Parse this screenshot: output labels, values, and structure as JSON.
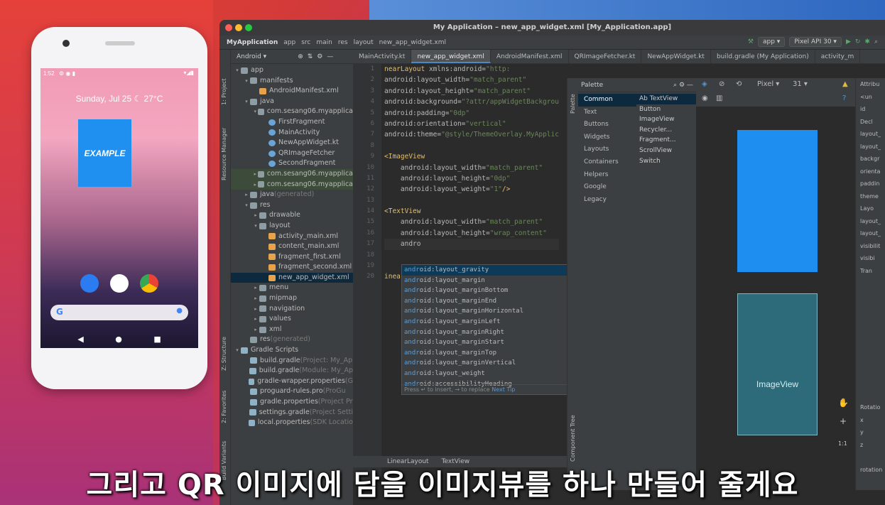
{
  "phone": {
    "status_time": "1:52",
    "status_icons": "⚙ ◉ ▮",
    "status_right": "▾◢▮",
    "date_weather": "Sunday, Jul 25 ☾ 27°C",
    "widget_label": "EXAMPLE",
    "search_logo": "G",
    "mic": "●",
    "nav_back": "◀",
    "nav_home": "●",
    "nav_recents": "■"
  },
  "ide": {
    "window_title": "My Application – new_app_widget.xml [My_Application.app]",
    "breadcrumbs": [
      "MyApplication",
      "app",
      "src",
      "main",
      "res",
      "layout",
      "new_app_widget.xml"
    ],
    "run_config": "app ▾",
    "device": "Pixel API 30 ▾",
    "tabs": [
      "MainActivity.kt",
      "new_app_widget.xml",
      "AndroidManifest.xml",
      "QRImageFetcher.kt",
      "NewAppWidget.kt",
      "build.gradle (My Application)",
      "activity_m"
    ],
    "project_view": "Android ▾",
    "left_strip": [
      "1: Project",
      "Resource Manager",
      "Z: Structure",
      "2: Favorites",
      "Build Variants"
    ],
    "tree": [
      {
        "label": "app",
        "indent": 0,
        "arrow": "▾",
        "icon": "fold"
      },
      {
        "label": "manifests",
        "indent": 1,
        "arrow": "▾",
        "icon": "fold"
      },
      {
        "label": "AndroidManifest.xml",
        "indent": 2,
        "arrow": "",
        "icon": "xml"
      },
      {
        "label": "java",
        "indent": 1,
        "arrow": "▾",
        "icon": "fold"
      },
      {
        "label": "com.sesang06.myapplica",
        "indent": 2,
        "arrow": "▾",
        "icon": "fold"
      },
      {
        "label": "FirstFragment",
        "indent": 3,
        "arrow": "",
        "icon": "kt"
      },
      {
        "label": "MainActivity",
        "indent": 3,
        "arrow": "",
        "icon": "kt"
      },
      {
        "label": "NewAppWidget.kt",
        "indent": 3,
        "arrow": "",
        "icon": "kt"
      },
      {
        "label": "QRImageFetcher",
        "indent": 3,
        "arrow": "",
        "icon": "kt"
      },
      {
        "label": "SecondFragment",
        "indent": 3,
        "arrow": "",
        "icon": "kt"
      },
      {
        "label": "com.sesang06.myapplica",
        "indent": 2,
        "arrow": "▸",
        "icon": "fold",
        "hl": true
      },
      {
        "label": "com.sesang06.myapplica",
        "indent": 2,
        "arrow": "▸",
        "icon": "fold",
        "hl": true
      },
      {
        "label": "java",
        "indent": 1,
        "arrow": "▸",
        "icon": "fold",
        "note": " (generated)"
      },
      {
        "label": "res",
        "indent": 1,
        "arrow": "▾",
        "icon": "fold"
      },
      {
        "label": "drawable",
        "indent": 2,
        "arrow": "▸",
        "icon": "fold"
      },
      {
        "label": "layout",
        "indent": 2,
        "arrow": "▾",
        "icon": "fold"
      },
      {
        "label": "activity_main.xml",
        "indent": 3,
        "arrow": "",
        "icon": "xml"
      },
      {
        "label": "content_main.xml",
        "indent": 3,
        "arrow": "",
        "icon": "xml"
      },
      {
        "label": "fragment_first.xml",
        "indent": 3,
        "arrow": "",
        "icon": "xml"
      },
      {
        "label": "fragment_second.xml",
        "indent": 3,
        "arrow": "",
        "icon": "xml"
      },
      {
        "label": "new_app_widget.xml",
        "indent": 3,
        "arrow": "",
        "icon": "xml",
        "sel": true
      },
      {
        "label": "menu",
        "indent": 2,
        "arrow": "▸",
        "icon": "fold"
      },
      {
        "label": "mipmap",
        "indent": 2,
        "arrow": "▸",
        "icon": "fold"
      },
      {
        "label": "navigation",
        "indent": 2,
        "arrow": "▸",
        "icon": "fold"
      },
      {
        "label": "values",
        "indent": 2,
        "arrow": "▸",
        "icon": "fold"
      },
      {
        "label": "xml",
        "indent": 2,
        "arrow": "▸",
        "icon": "fold"
      },
      {
        "label": "res",
        "indent": 1,
        "arrow": "",
        "icon": "fold",
        "note": " (generated)"
      },
      {
        "label": "Gradle Scripts",
        "indent": 0,
        "arrow": "▾",
        "icon": "grd"
      },
      {
        "label": "build.gradle",
        "indent": 1,
        "arrow": "",
        "icon": "grd",
        "note": " (Project: My_Ap"
      },
      {
        "label": "build.gradle",
        "indent": 1,
        "arrow": "",
        "icon": "grd",
        "note": " (Module: My_Ap"
      },
      {
        "label": "gradle-wrapper.properties",
        "indent": 1,
        "arrow": "",
        "icon": "grd",
        "note": " (G"
      },
      {
        "label": "proguard-rules.pro",
        "indent": 1,
        "arrow": "",
        "icon": "grd",
        "note": " (ProGu"
      },
      {
        "label": "gradle.properties",
        "indent": 1,
        "arrow": "",
        "icon": "grd",
        "note": " (Project Pr"
      },
      {
        "label": "settings.gradle",
        "indent": 1,
        "arrow": "",
        "icon": "grd",
        "note": " (Project Setti"
      },
      {
        "label": "local.properties",
        "indent": 1,
        "arrow": "",
        "icon": "grd",
        "note": " (SDK Locatio"
      }
    ],
    "code_lines": [
      {
        "n": "1",
        "html": "<span class='t'>nearLayout</span> <span class='a'>xmlns:android=</span><span class='v'>\"http:</span>"
      },
      {
        "n": "2",
        "html": "<span class='a'>android:layout_width=</span><span class='v'>\"match_parent\"</span>"
      },
      {
        "n": "3",
        "html": "<span class='a'>android:layout_height=</span><span class='v'>\"match_parent\"</span>"
      },
      {
        "n": "4",
        "html": "<span class='a'>android:background=</span><span class='v'>\"?attr/appWidgetBackgrou</span>"
      },
      {
        "n": "5",
        "html": "<span class='a'>android:padding=</span><span class='v'>\"0dp\"</span>"
      },
      {
        "n": "6",
        "html": "<span class='a'>android:orientation=</span><span class='v'>\"vertical\"</span>"
      },
      {
        "n": "7",
        "html": "<span class='a'>android:theme=</span><span class='v'>\"@style/ThemeOverlay.MyApplic</span>"
      },
      {
        "n": "8",
        "html": ""
      },
      {
        "n": "9",
        "html": "<span class='t'>&lt;ImageView</span>"
      },
      {
        "n": "10",
        "html": "    <span class='a'>android:layout_width=</span><span class='v'>\"match_parent\"</span>"
      },
      {
        "n": "11",
        "html": "    <span class='a'>android:layout_height=</span><span class='v'>\"0dp\"</span>"
      },
      {
        "n": "12",
        "html": "    <span class='a'>android:layout_weight=</span><span class='v'>\"1\"</span><span class='t'>/&gt;</span>"
      },
      {
        "n": "13",
        "html": ""
      },
      {
        "n": "14",
        "html": "<span class='t'>&lt;TextView</span>"
      },
      {
        "n": "15",
        "html": "    <span class='a'>android:layout_width=</span><span class='v'>\"match_parent\"</span>"
      },
      {
        "n": "16",
        "html": "    <span class='a'>android:layout_height=</span><span class='v'>\"wrap_content\"</span>"
      },
      {
        "n": "17",
        "html": "    <span class='a'>andro</span>",
        "cur": true
      },
      {
        "n": "18",
        "html": ""
      },
      {
        "n": "19",
        "html": ""
      },
      {
        "n": "20",
        "html": "<span class='t'>inear</span>"
      }
    ],
    "completions": [
      "layout_gravity",
      "layout_margin",
      "layout_marginBottom",
      "layout_marginEnd",
      "layout_marginHorizontal",
      "layout_marginLeft",
      "layout_marginRight",
      "layout_marginStart",
      "layout_marginTop",
      "layout_marginVertical",
      "layout_weight",
      "accessibilityHeading"
    ],
    "completion_prefix": "andr",
    "completion_suffix": "oid:",
    "popup_hint": "Press ↵ to insert, → to replace",
    "popup_next": "Next Tip",
    "crumb_bottom": [
      "LinearLayout",
      "TextView"
    ],
    "palette_title": "Palette",
    "palette_categories": [
      "Common",
      "Text",
      "Buttons",
      "Widgets",
      "Layouts",
      "Containers",
      "Helpers",
      "Google",
      "Legacy"
    ],
    "palette_items": [
      "Ab TextView",
      "Button",
      "ImageView",
      "Recycler...",
      "Fragment...",
      "ScrollView",
      "Switch"
    ],
    "design_device": "Pixel ▾",
    "design_api": "31 ▾",
    "preview_label": "ImageView",
    "attr_title": "Attribu",
    "attrs": [
      "<un",
      "id",
      "Decl",
      "layout_",
      "layout_",
      "backgr",
      "orienta",
      "paddin",
      "theme",
      "Layo",
      "layout_",
      "layout_",
      "visibilit",
      "visibi",
      "Tran",
      "",
      "",
      "",
      "",
      "",
      "",
      "",
      "",
      "",
      "",
      "Rotatio",
      "x",
      "y",
      "z",
      "",
      "rotation"
    ],
    "zoom_label": "1:1",
    "palette_strip": "Palette",
    "component_strip": "Component Tree"
  },
  "subtitle": "그리고 QR 이미지에 담을 이미지뷰를 하나 만들어 줄게요"
}
